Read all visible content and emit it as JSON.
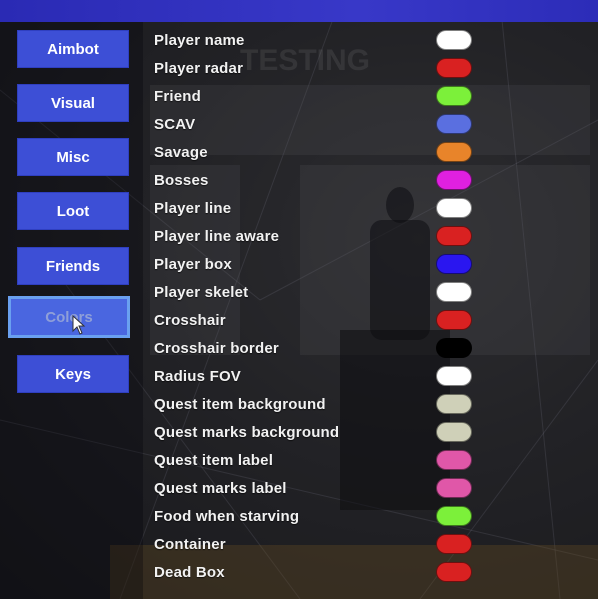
{
  "sidebar": {
    "items": [
      {
        "label": "Aimbot",
        "active": false
      },
      {
        "label": "Visual",
        "active": false
      },
      {
        "label": "Misc",
        "active": false
      },
      {
        "label": "Loot",
        "active": false
      },
      {
        "label": "Friends",
        "active": false
      },
      {
        "label": "Colors",
        "active": true
      },
      {
        "label": "Keys",
        "active": false
      }
    ]
  },
  "colors": {
    "rows": [
      {
        "label": "Player name",
        "color": "#ffffff"
      },
      {
        "label": "Player radar",
        "color": "#d92121"
      },
      {
        "label": "Friend",
        "color": "#7cf03a"
      },
      {
        "label": "SCAV",
        "color": "#5a6fe0"
      },
      {
        "label": "Savage",
        "color": "#e8842a"
      },
      {
        "label": "Bosses",
        "color": "#e020e0"
      },
      {
        "label": "Player line",
        "color": "#ffffff"
      },
      {
        "label": "Player line aware",
        "color": "#d92121"
      },
      {
        "label": "Player box",
        "color": "#2a16f0"
      },
      {
        "label": "Player skelet",
        "color": "#ffffff"
      },
      {
        "label": "Crosshair",
        "color": "#d92121"
      },
      {
        "label": "Crosshair border",
        "color": "#000000"
      },
      {
        "label": "Radius FOV",
        "color": "#ffffff"
      },
      {
        "label": "Quest item background",
        "color": "#cfd0b8"
      },
      {
        "label": "Quest marks background",
        "color": "#cfd0b8"
      },
      {
        "label": "Quest item label",
        "color": "#e057a8"
      },
      {
        "label": "Quest marks label",
        "color": "#e057a8"
      },
      {
        "label": "Food when starving",
        "color": "#7cf03a"
      },
      {
        "label": "Container",
        "color": "#d92121"
      },
      {
        "label": "Dead Box",
        "color": "#d92121"
      }
    ]
  },
  "background": {
    "banner_text": "TESTING"
  }
}
